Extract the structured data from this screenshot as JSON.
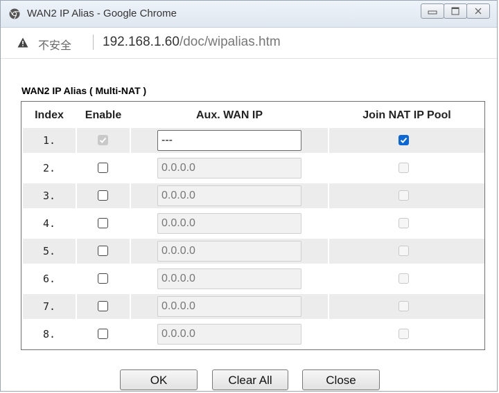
{
  "window": {
    "title": "WAN2 IP Alias - Google Chrome",
    "insecure_label": "不安全",
    "url_host": "192.168.1.60",
    "url_path": "/doc/wipalias.htm"
  },
  "section": {
    "title": "WAN2 IP Alias ( Multi-NAT )"
  },
  "table": {
    "headers": {
      "index": "Index",
      "enable": "Enable",
      "aux_wan_ip": "Aux. WAN IP",
      "join_nat_ip_pool": "Join NAT IP Pool"
    },
    "rows": [
      {
        "index": "1.",
        "enable": true,
        "enable_disabled": true,
        "ip": "---",
        "ip_editable": true,
        "join_nat": true,
        "join_disabled": false
      },
      {
        "index": "2.",
        "enable": false,
        "enable_disabled": false,
        "ip": "0.0.0.0",
        "ip_editable": false,
        "join_nat": false,
        "join_disabled": true
      },
      {
        "index": "3.",
        "enable": false,
        "enable_disabled": false,
        "ip": "0.0.0.0",
        "ip_editable": false,
        "join_nat": false,
        "join_disabled": true
      },
      {
        "index": "4.",
        "enable": false,
        "enable_disabled": false,
        "ip": "0.0.0.0",
        "ip_editable": false,
        "join_nat": false,
        "join_disabled": true
      },
      {
        "index": "5.",
        "enable": false,
        "enable_disabled": false,
        "ip": "0.0.0.0",
        "ip_editable": false,
        "join_nat": false,
        "join_disabled": true
      },
      {
        "index": "6.",
        "enable": false,
        "enable_disabled": false,
        "ip": "0.0.0.0",
        "ip_editable": false,
        "join_nat": false,
        "join_disabled": true
      },
      {
        "index": "7.",
        "enable": false,
        "enable_disabled": false,
        "ip": "0.0.0.0",
        "ip_editable": false,
        "join_nat": false,
        "join_disabled": true
      },
      {
        "index": "8.",
        "enable": false,
        "enable_disabled": false,
        "ip": "0.0.0.0",
        "ip_editable": false,
        "join_nat": false,
        "join_disabled": true
      }
    ]
  },
  "buttons": {
    "ok": "OK",
    "clear_all": "Clear All",
    "close": "Close"
  },
  "colors": {
    "accent_checkbox": "#0b66d6",
    "row_shade": "#ececec"
  }
}
